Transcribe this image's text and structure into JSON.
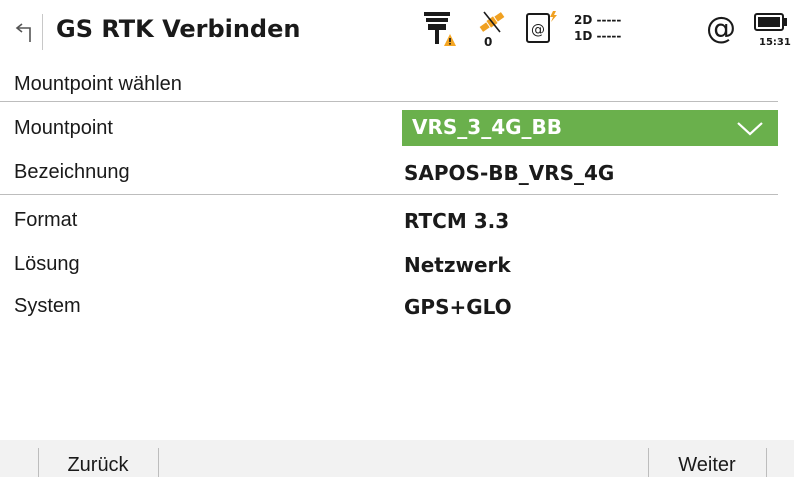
{
  "header": {
    "title": "GS RTK Verbinden",
    "satellite_count": "0",
    "quality_2d": "2D -----",
    "quality_1d": "1D -----",
    "at_symbol": "@",
    "time": "15:31"
  },
  "section": {
    "heading": "Mountpoint wählen"
  },
  "fields": {
    "mountpoint": {
      "label": "Mountpoint",
      "value": "VRS_3_4G_BB"
    },
    "bezeichnung": {
      "label": "Bezeichnung",
      "value": "SAPOS-BB_VRS_4G"
    },
    "format": {
      "label": "Format",
      "value": "RTCM 3.3"
    },
    "loesung": {
      "label": "Lösung",
      "value": "Netzwerk"
    },
    "system": {
      "label": "System",
      "value": "GPS+GLO"
    }
  },
  "footer": {
    "back_label": "Zurück",
    "next_label": "Weiter"
  },
  "colors": {
    "dropdown_bg": "#6ab04c",
    "warning": "#f5a623",
    "satellite": "#f0a020"
  },
  "icons": {
    "back": "back-arrow-icon",
    "rtk": "rtk-antenna-warning-icon",
    "satellite": "satellite-icon",
    "device": "device-at-icon",
    "battery": "battery-icon",
    "dropdown": "chevron-down-icon"
  }
}
